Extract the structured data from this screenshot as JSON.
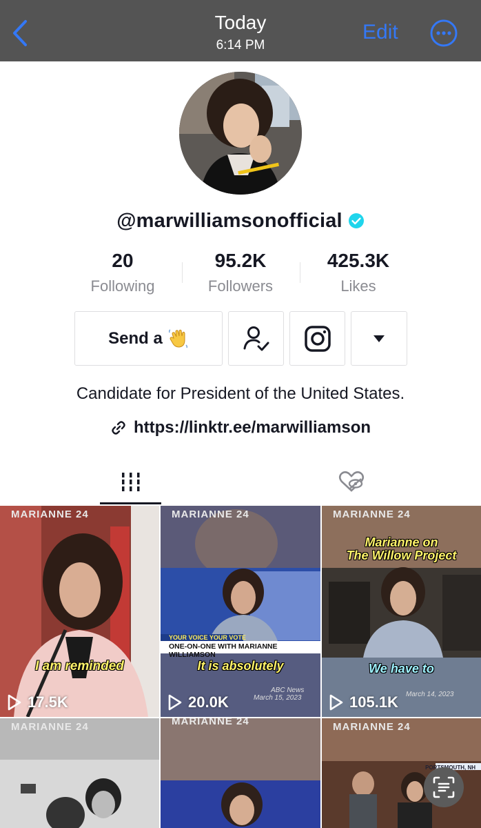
{
  "header": {
    "title": "Today",
    "subtitle": "6:14 PM",
    "edit_label": "Edit"
  },
  "profile": {
    "username": "@marwilliamsonofficial",
    "stats": [
      {
        "value": "20",
        "label": "Following"
      },
      {
        "value": "95.2K",
        "label": "Followers"
      },
      {
        "value": "425.3K",
        "label": "Likes"
      }
    ],
    "send_button_label": "Send a",
    "bio": "Candidate for President of the United States.",
    "link": "https://linktr.ee/marwilliamson"
  },
  "tabs": {
    "active": "videos",
    "items": [
      "videos-grid-icon",
      "liked-videos-hidden-icon"
    ]
  },
  "videos": [
    {
      "brand": "MARIANNE 24",
      "caption": "I am reminded",
      "views": "17.5K"
    },
    {
      "brand": "MARIANNE 24",
      "caption": "It is absolutely",
      "views": "20.0K",
      "banner_top": "YOUR VOICE YOUR VOTE",
      "banner": "ONE-ON-ONE WITH MARIANNE WILLIAMSON",
      "source": "ABC News",
      "date": "March 15, 2023"
    },
    {
      "brand": "MARIANNE 24",
      "title_line1": "Marianne on",
      "title_line2": "The Willow Project",
      "caption": "We have to",
      "views": "105.1K",
      "date": "March 14, 2023"
    },
    {
      "brand": "MARIANNE 24"
    },
    {
      "brand": "MARIANNE 24"
    },
    {
      "brand": "MARIANNE 24",
      "location": "PORTSMOUTH, NH"
    }
  ],
  "colors": {
    "accent": "#3478f6",
    "verified": "#20d5ec",
    "caption": "#fff36a",
    "topbar": "#545454"
  }
}
